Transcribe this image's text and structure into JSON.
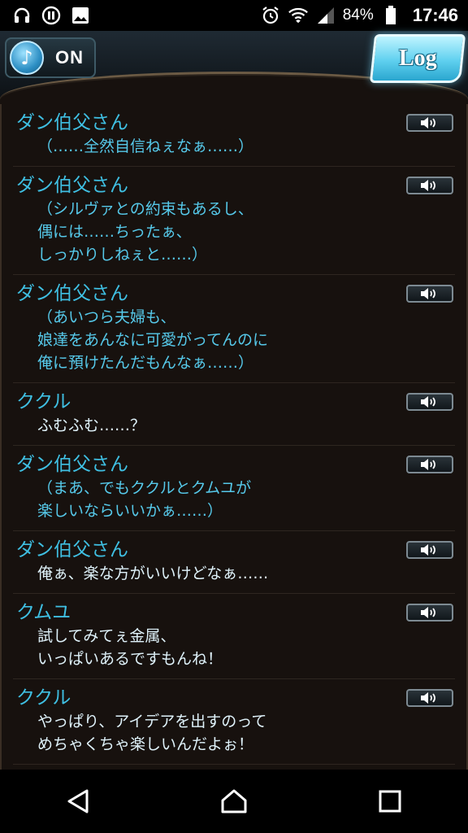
{
  "status_bar": {
    "battery_percent": "84%",
    "time": "17:46",
    "icons": [
      "headset-icon",
      "pause-circle-icon",
      "image-icon",
      "alarm-icon",
      "wifi-icon",
      "signal-icon",
      "battery-icon"
    ]
  },
  "header": {
    "music_toggle_label": "ON",
    "log_button_label": "Log"
  },
  "entries": [
    {
      "speaker": "ダン伯父さん",
      "lines": [
        "（……全然自信ねぇなぁ……）"
      ]
    },
    {
      "speaker": "ダン伯父さん",
      "lines": [
        "（シルヴァとの約束もあるし、",
        "偶には……ちったぁ、",
        "しっかりしねぇと……）"
      ]
    },
    {
      "speaker": "ダン伯父さん",
      "lines": [
        "（あいつら夫婦も、",
        "娘達をあんなに可愛がってんのに",
        "俺に預けたんだもんなぁ……）"
      ]
    },
    {
      "speaker": "ククル",
      "lines": [
        "ふむふむ……？"
      ]
    },
    {
      "speaker": "ダン伯父さん",
      "lines": [
        "（まあ、でもククルとクムユが",
        "楽しいならいいかぁ……）"
      ]
    },
    {
      "speaker": "ダン伯父さん",
      "lines": [
        "俺ぁ、楽な方がいいけどなぁ……"
      ]
    },
    {
      "speaker": "クムユ",
      "lines": [
        "試してみてぇ金属、",
        "いっぱいあるですもんね！"
      ]
    },
    {
      "speaker": "ククル",
      "lines": [
        "やっぱり、アイデアを出すのって",
        "めちゃくちゃ楽しいんだよぉ！"
      ]
    }
  ],
  "navbar": {
    "icons": [
      "back-icon",
      "home-icon",
      "recents-icon"
    ]
  }
}
